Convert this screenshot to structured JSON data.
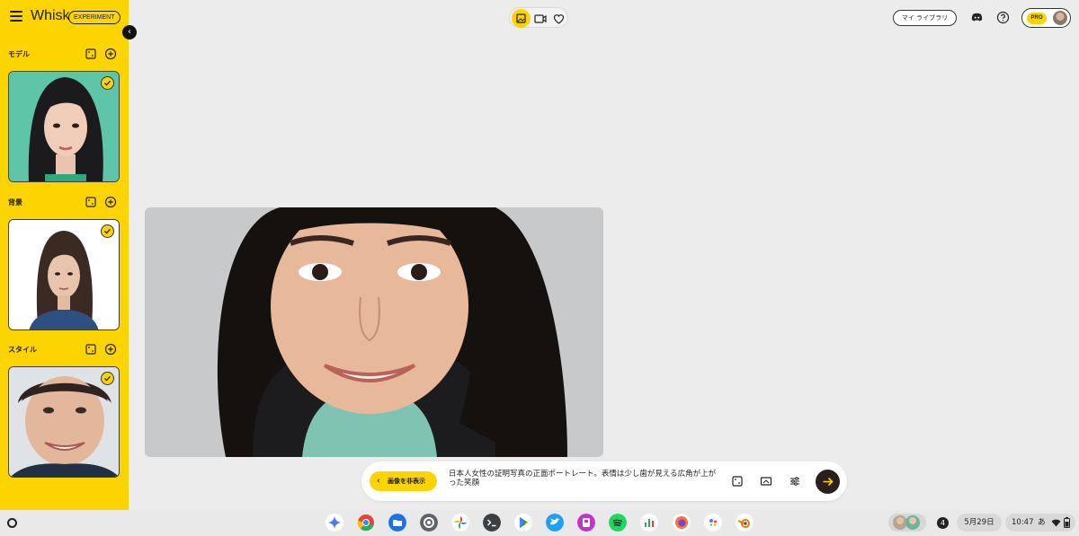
{
  "app": {
    "name": "Whisk",
    "badge": "EXPERIMENT",
    "accent": "#fcd401"
  },
  "sidebar": {
    "sections": [
      {
        "title": "モデル"
      },
      {
        "title": "背景"
      },
      {
        "title": "スタイル"
      }
    ]
  },
  "header": {
    "tools": [
      "image-tool-icon",
      "video-tool-icon",
      "favorites-heart-icon"
    ],
    "library_label": "マイ ライブラリ",
    "pro_label": "PRO"
  },
  "prompt": {
    "hide_label": "画像を非表示",
    "text": "日本人女性の証明写真の正面ポートレート。表情は少し歯が見える広角が上がった笑顔"
  },
  "shelf": {
    "notification_count": "4",
    "date": "5月29日",
    "time": "10:47",
    "ime": "あ"
  }
}
